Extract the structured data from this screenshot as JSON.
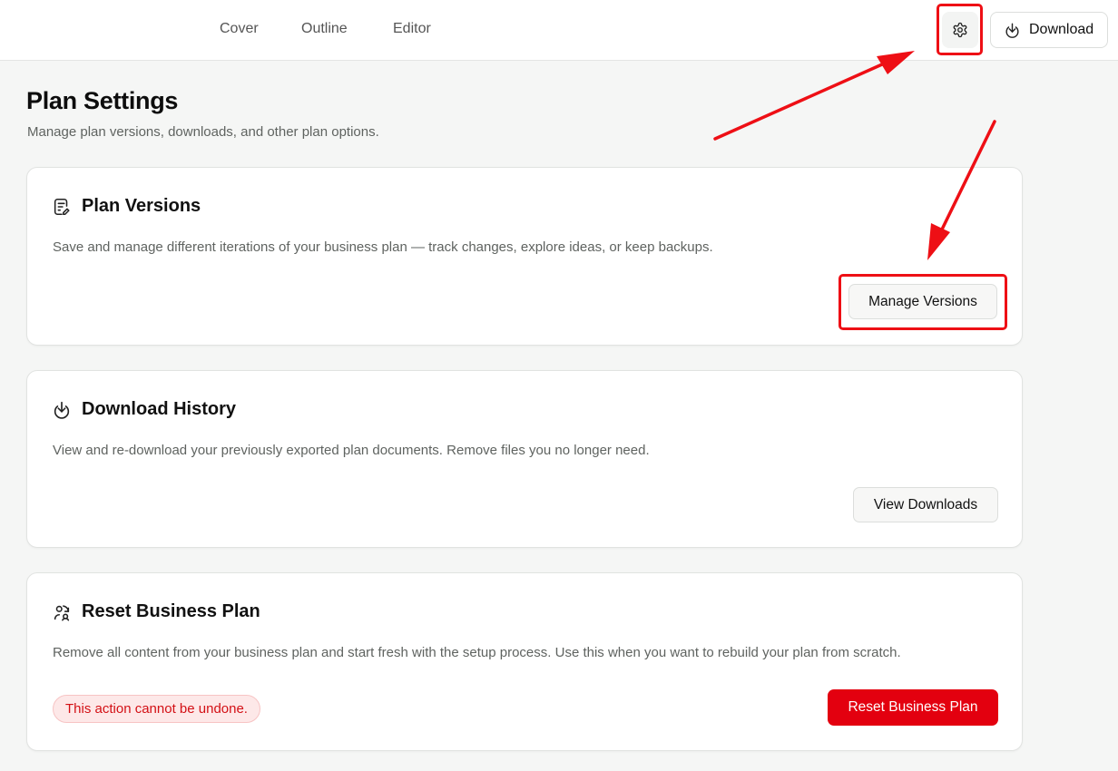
{
  "topbar": {
    "tabs": [
      "Cover",
      "Outline",
      "Editor"
    ],
    "settings_icon": "gear-icon",
    "download_label": "Download",
    "download_icon": "download-icon"
  },
  "page": {
    "title": "Plan Settings",
    "subtitle": "Manage plan versions, downloads, and other plan options."
  },
  "cards": [
    {
      "icon": "document-edit-icon",
      "title": "Plan Versions",
      "description": "Save and manage different iterations of your business plan — track changes, explore ideas, or keep backups.",
      "button_label": "Manage Versions"
    },
    {
      "icon": "download-icon",
      "title": "Download History",
      "description": "View and re-download your previously exported plan documents. Remove files you no longer need.",
      "button_label": "View Downloads"
    },
    {
      "icon": "reset-user-icon",
      "title": "Reset Business Plan",
      "description": "Remove all content from your business plan and start fresh with the setup process. Use this when you want to rebuild your plan from scratch.",
      "warning": "This action cannot be undone.",
      "button_label": "Reset Business Plan"
    }
  ],
  "colors": {
    "accent_danger": "#e3000f",
    "annotation": "#ee0f15",
    "background": "#f5f6f5"
  }
}
